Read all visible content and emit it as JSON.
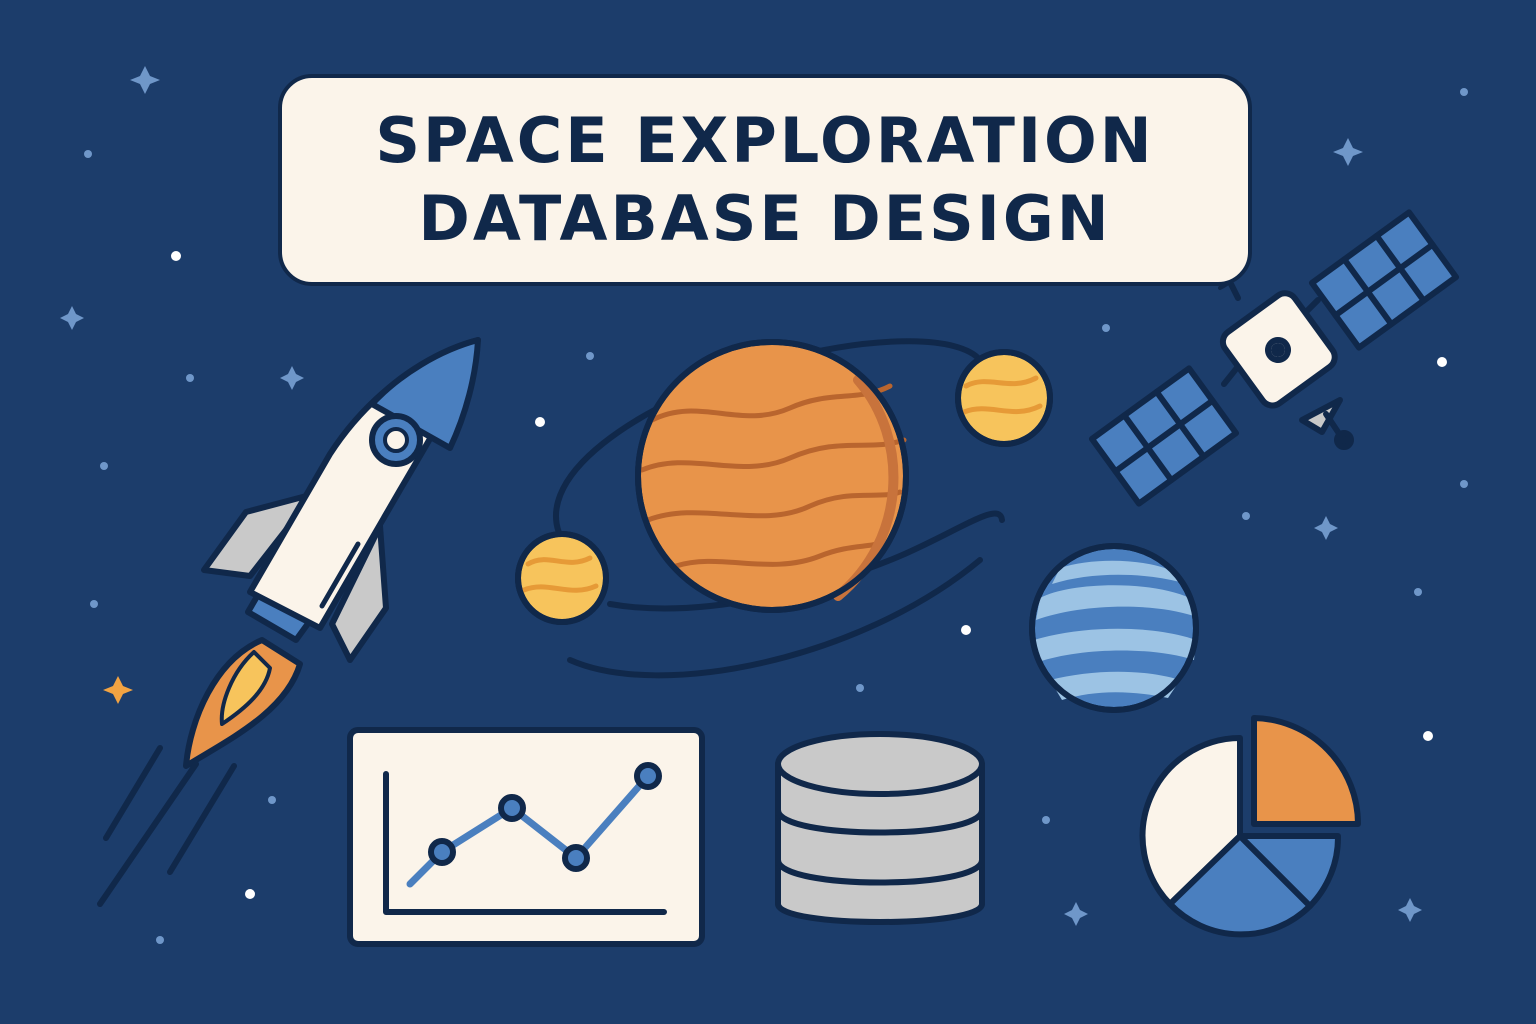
{
  "title": {
    "line1": "SPACE EXPLORATION",
    "line2": "DATABASE DESIGN"
  },
  "colors": {
    "background": "#1c3d6b",
    "outline": "#10284a",
    "cream": "#fbf4ea",
    "orange": "#e8944a",
    "yellow": "#f7c45c",
    "blue": "#4a7fbf",
    "light_blue": "#9cc3e4",
    "gray": "#c9c9c9"
  },
  "icons": [
    "rocket-icon",
    "planet-with-orbit-icon",
    "moon-icon",
    "satellite-icon",
    "striped-planet-icon",
    "line-chart-icon",
    "database-icon",
    "pie-chart-icon",
    "star-icon"
  ]
}
